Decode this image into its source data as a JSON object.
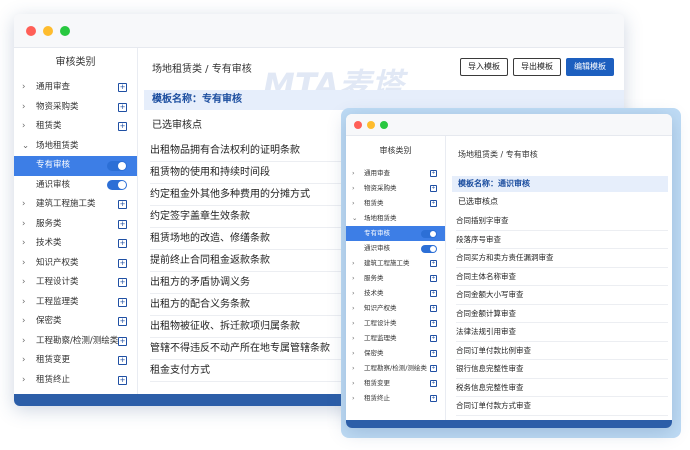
{
  "colors": {
    "accent": "#1d5fbf",
    "active": "#3d7ee6",
    "footer": "#2c5ea8",
    "dot_red": "#ff5f57",
    "dot_yellow": "#febc2e",
    "dot_green": "#28c840"
  },
  "logo_text": "MTA麦塔",
  "back": {
    "sidebar": {
      "title": "审核类别",
      "items": [
        {
          "label": "通用审查"
        },
        {
          "label": "物资采购类"
        },
        {
          "label": "租赁类"
        },
        {
          "label": "场地租赁类"
        },
        {
          "label": "专有审核"
        },
        {
          "label": "通识审核"
        },
        {
          "label": "建筑工程施工类"
        },
        {
          "label": "服务类"
        },
        {
          "label": "技术类"
        },
        {
          "label": "知识产权类"
        },
        {
          "label": "工程设计类"
        },
        {
          "label": "工程监理类"
        },
        {
          "label": "保密类"
        },
        {
          "label": "工程勘察/检测/测绘类"
        },
        {
          "label": "租赁变更"
        },
        {
          "label": "租赁终止"
        }
      ]
    },
    "breadcrumb": "场地租赁类 / 专有审核",
    "buttons": {
      "import": "导入模板",
      "export": "导出模板",
      "edit": "编辑模板"
    },
    "template_name": "模板名称：专有审核",
    "selected_title": "已选审核点",
    "rows": [
      "出租物品拥有合法权利的证明条款",
      "租赁物的使用和持续时间段",
      "约定租金外其他多种费用的分摊方式",
      "约定签字盖章生效条款",
      "租赁场地的改造、修缮条款",
      "提前终止合同租金返款条款",
      "出租方的矛盾协调义务",
      "出租方的配合义务条款",
      "出租物被征收、拆迁款项归属条款",
      "管辖不得违反不动产所在地专属管辖条款",
      "租金支付方式"
    ]
  },
  "front": {
    "sidebar": {
      "title": "审核类别",
      "items": [
        {
          "label": "通用审查"
        },
        {
          "label": "物资采购类"
        },
        {
          "label": "租赁类"
        },
        {
          "label": "场地租赁类"
        },
        {
          "label": "专有审核"
        },
        {
          "label": "通识审核"
        },
        {
          "label": "建筑工程施工类"
        },
        {
          "label": "服务类"
        },
        {
          "label": "技术类"
        },
        {
          "label": "知识产权类"
        },
        {
          "label": "工程设计类"
        },
        {
          "label": "工程监理类"
        },
        {
          "label": "保密类"
        },
        {
          "label": "工程勘察/检测/测绘类"
        },
        {
          "label": "租赁变更"
        },
        {
          "label": "租赁终止"
        }
      ]
    },
    "breadcrumb": "场地租赁类 / 专有审核",
    "template_name": "模板名称：通识审核",
    "selected_title": "已选审核点",
    "rows": [
      "合同插别字审查",
      "段落序号审查",
      "合同买方和卖方责任漏洞审查",
      "合同主体名称审查",
      "合同金额大小写审查",
      "合同金额计算审查",
      "法律法规引用审查",
      "合同订单付款比例审查",
      "银行信息完整性审查",
      "税务信息完整性审查",
      "合同订单付款方式审查"
    ]
  }
}
